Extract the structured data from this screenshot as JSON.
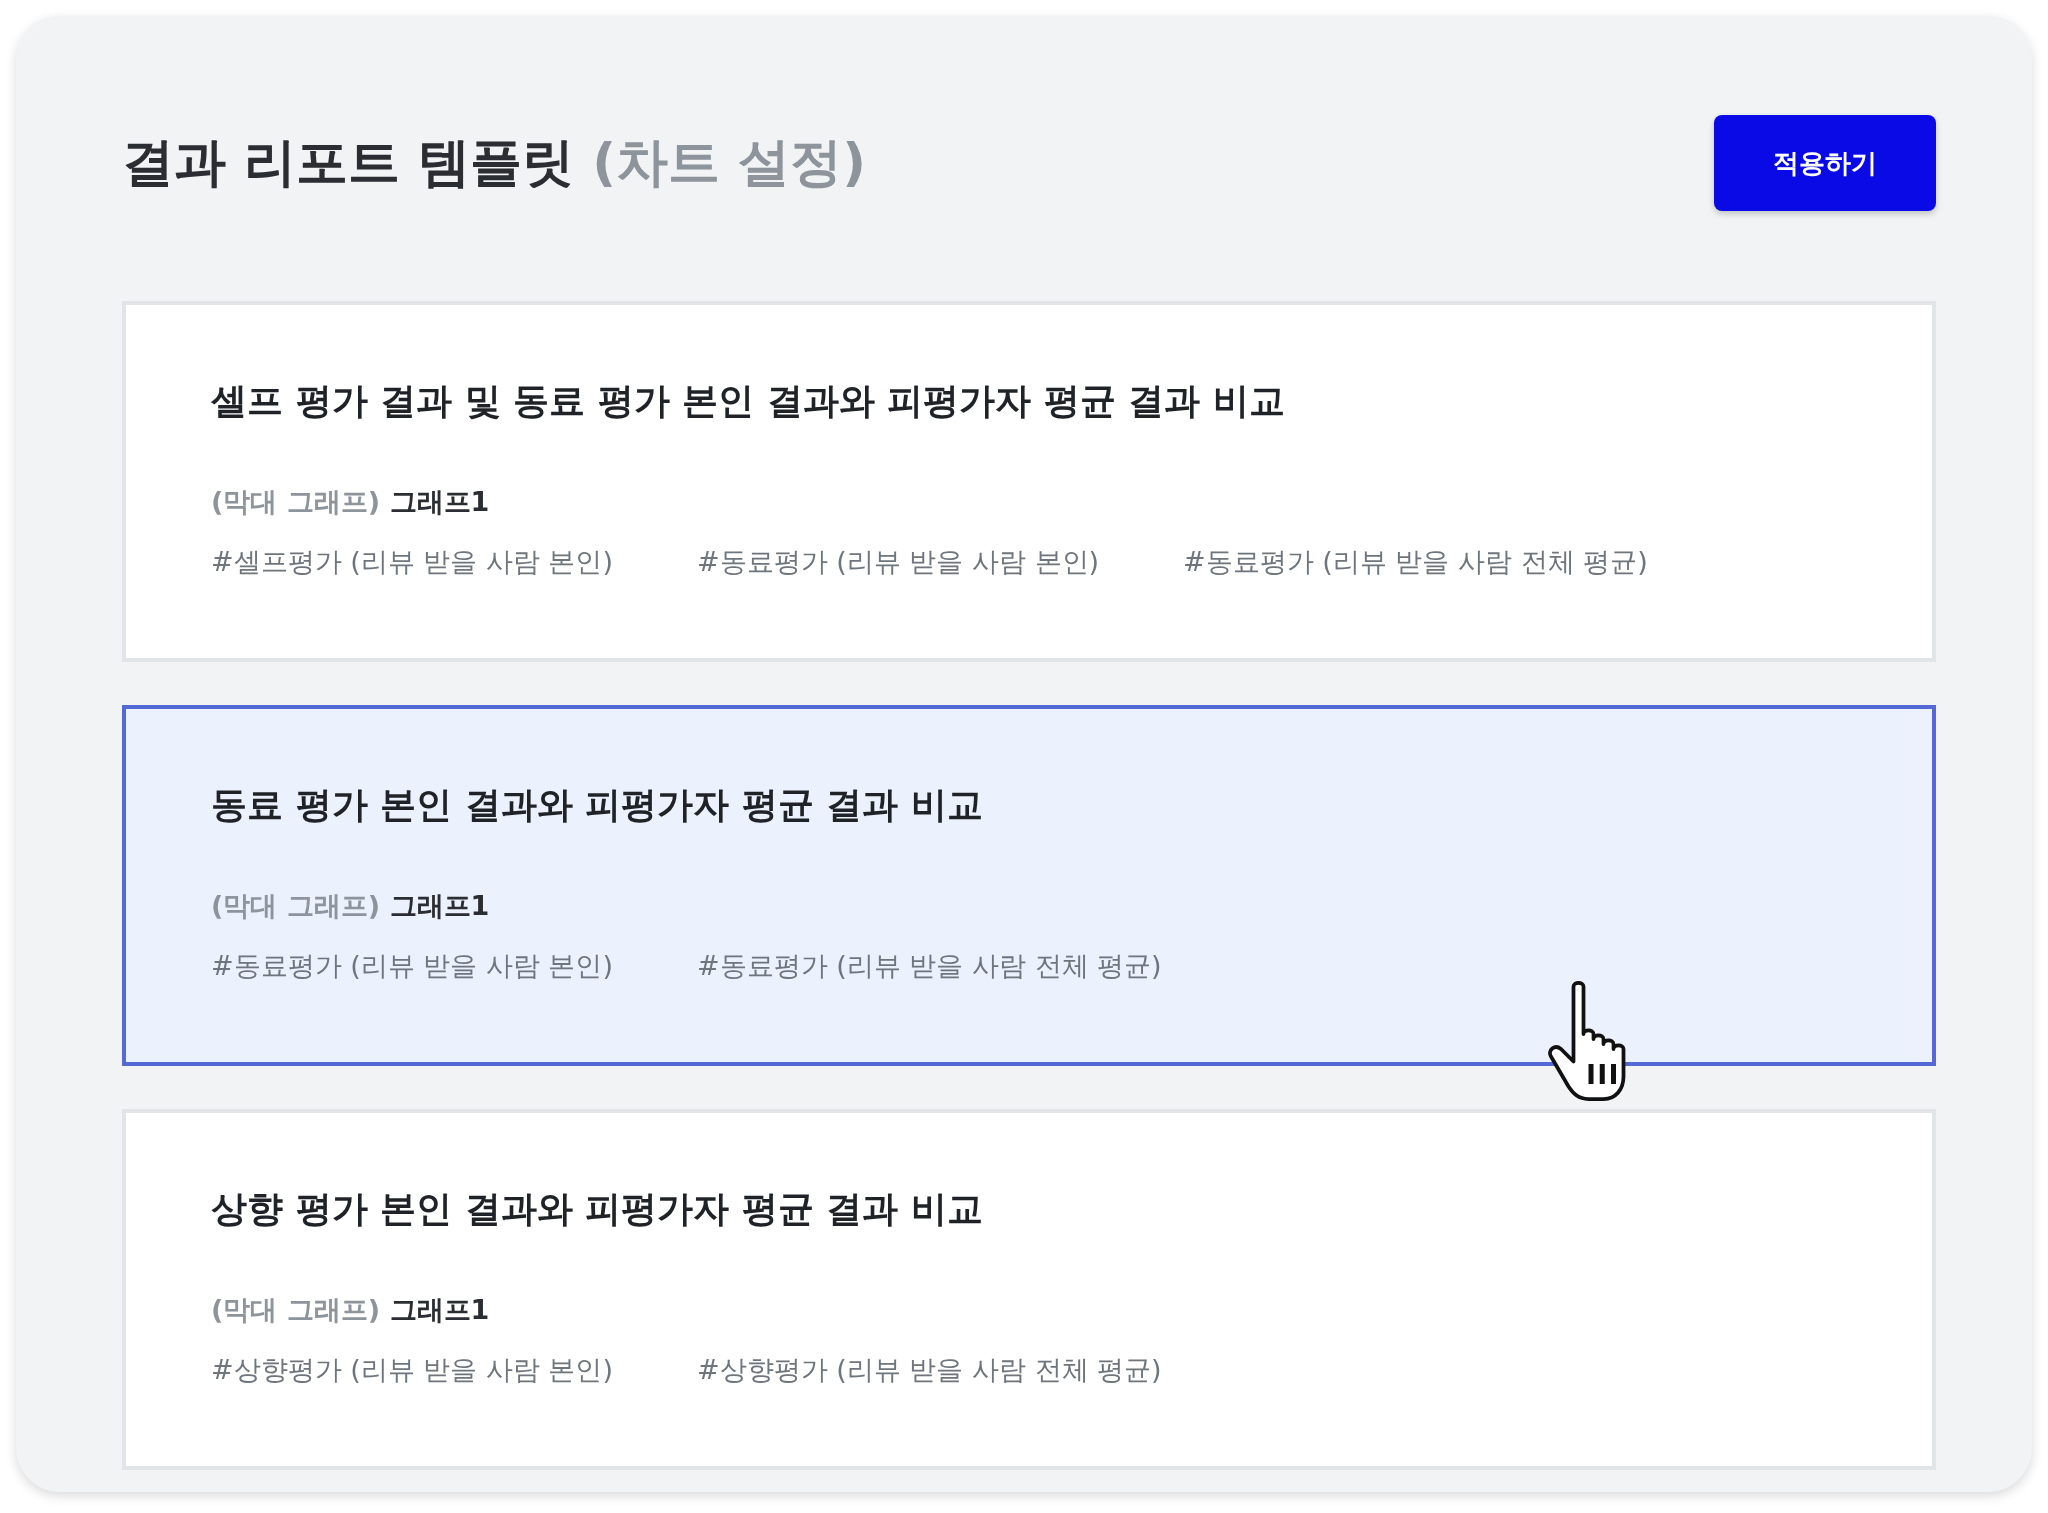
{
  "header": {
    "title": "결과 리포트 템플릿",
    "subtitle": "(차트 설정)",
    "apply_button": "적용하기"
  },
  "templates": [
    {
      "title": "셀프 평가 결과 및 동료 평가 본인 결과와 피평가자 평균 결과 비교",
      "graph_type": "(막대 그래프)",
      "graph_name": "그래프1",
      "tags": [
        "#셀프평가 (리뷰 받을 사람 본인)",
        "#동료평가 (리뷰 받을 사람 본인)",
        "#동료평가 (리뷰 받을 사람 전체 평균)"
      ],
      "selected": false
    },
    {
      "title": "동료 평가 본인 결과와 피평가자 평균 결과 비교",
      "graph_type": "(막대 그래프)",
      "graph_name": "그래프1",
      "tags": [
        "#동료평가 (리뷰 받을 사람 본인)",
        "#동료평가 (리뷰 받을 사람 전체 평균)"
      ],
      "selected": true
    },
    {
      "title": "상향 평가 본인 결과와 피평가자 평균 결과 비교",
      "graph_type": "(막대 그래프)",
      "graph_name": "그래프1",
      "tags": [
        "#상향평가 (리뷰 받을 사람 본인)",
        "#상향평가 (리뷰 받을 사람 전체 평균)"
      ],
      "selected": false
    }
  ]
}
